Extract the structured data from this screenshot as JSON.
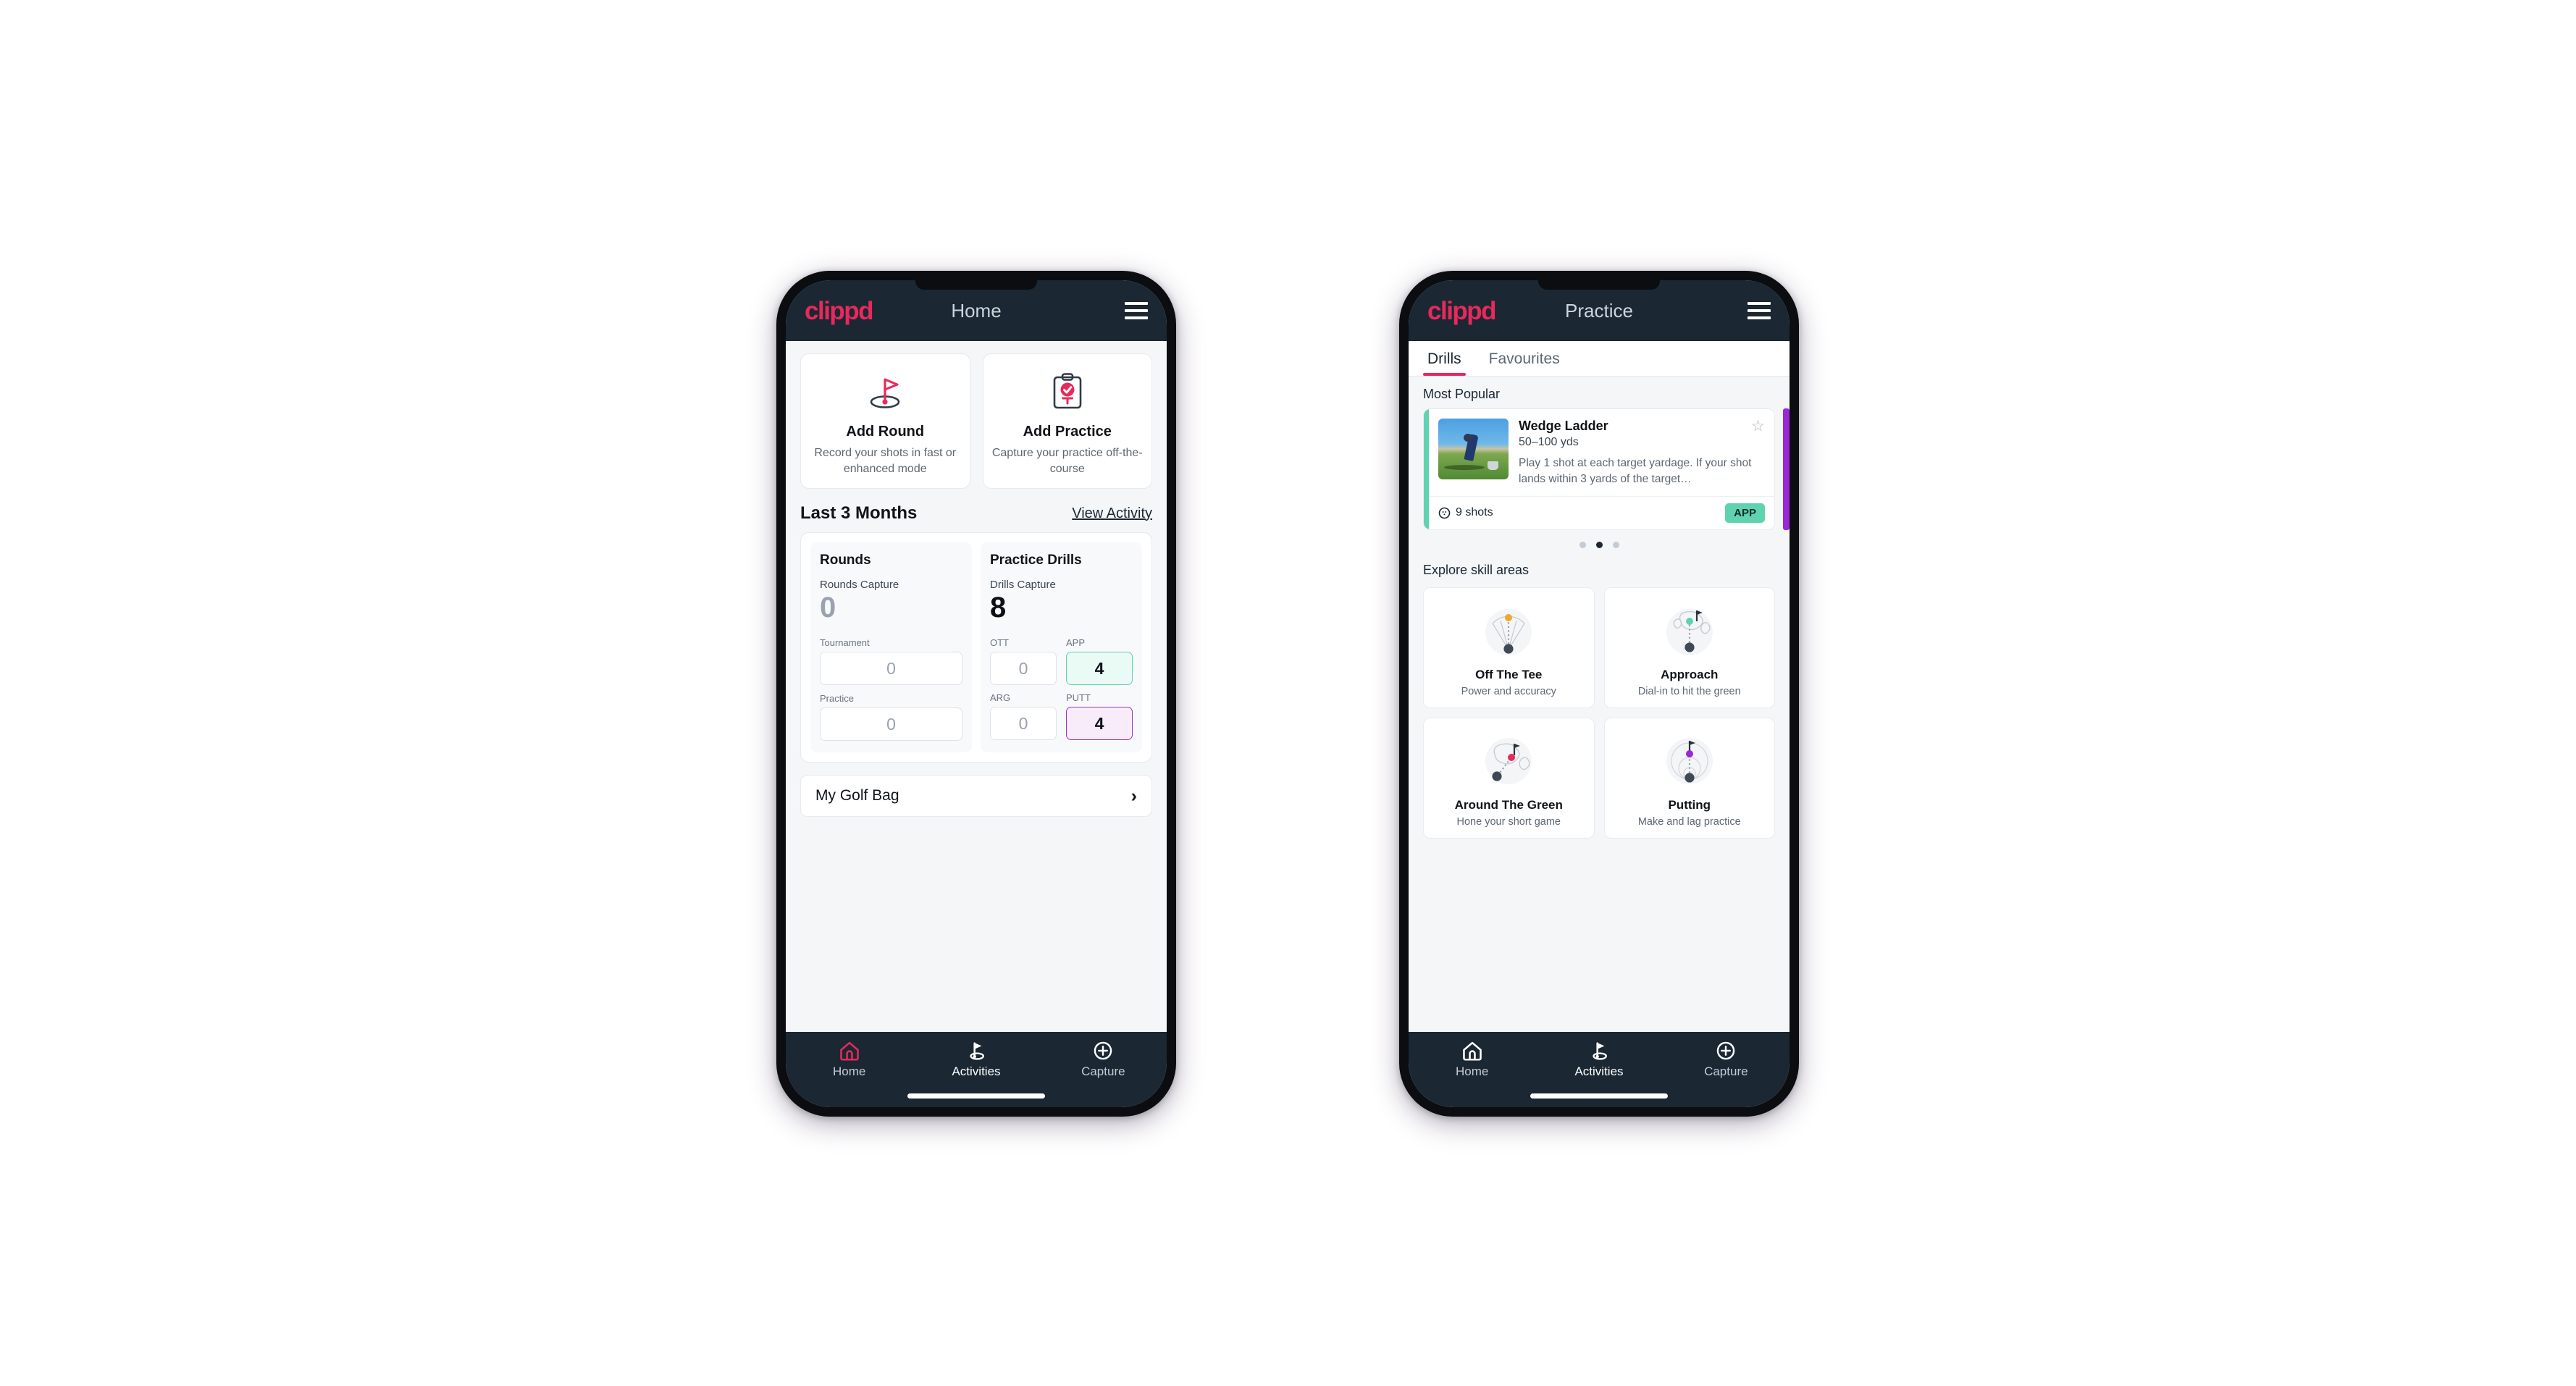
{
  "theme": {
    "brand_pink": "#e8295b",
    "navy": "#1b2733",
    "green_accent": "#5fd3b0",
    "purple_accent": "#9c36b5",
    "page_bg": "#f4f6f8"
  },
  "phone_home": {
    "appbar": {
      "logo": "clippd",
      "title": "Home",
      "menu_icon": "hamburger-menu-icon"
    },
    "actions": [
      {
        "icon": "golf-flag-hole-icon",
        "title": "Add Round",
        "subtitle": "Record your shots in fast or enhanced mode"
      },
      {
        "icon": "clipboard-check-tee-icon",
        "title": "Add Practice",
        "subtitle": "Capture your practice off-the-course"
      }
    ],
    "section": {
      "title": "Last 3 Months",
      "link": "View Activity"
    },
    "rounds": {
      "heading": "Rounds",
      "capture_label": "Rounds Capture",
      "capture_value": "0",
      "fields": [
        {
          "label": "Tournament",
          "value": "0",
          "accent": "none"
        },
        {
          "label": "Practice",
          "value": "0",
          "accent": "none"
        }
      ]
    },
    "drills": {
      "heading": "Practice Drills",
      "capture_label": "Drills Capture",
      "capture_value": "8",
      "fields": [
        {
          "label": "OTT",
          "value": "0",
          "accent": "none"
        },
        {
          "label": "APP",
          "value": "4",
          "accent": "green"
        },
        {
          "label": "ARG",
          "value": "0",
          "accent": "none"
        },
        {
          "label": "PUTT",
          "value": "4",
          "accent": "purple"
        }
      ]
    },
    "golf_bag": {
      "label": "My Golf Bag",
      "chevron": "chevron-right-icon"
    },
    "nav": [
      {
        "icon": "home-icon",
        "label": "Home",
        "state": "selected-pink-icon"
      },
      {
        "icon": "golf-flag-icon",
        "label": "Activities",
        "state": "default"
      },
      {
        "icon": "plus-circle-icon",
        "label": "Capture",
        "state": "default"
      }
    ]
  },
  "phone_practice": {
    "appbar": {
      "logo": "clippd",
      "title": "Practice",
      "menu_icon": "hamburger-menu-icon"
    },
    "tabs": [
      {
        "label": "Drills",
        "active": true
      },
      {
        "label": "Favourites",
        "active": false
      }
    ],
    "most_popular_label": "Most Popular",
    "drill_card": {
      "accent": "green",
      "title": "Wedge Ladder",
      "yardage": "50–100 yds",
      "description": "Play 1 shot at each target yardage. If your shot lands within 3 yards of the target…",
      "shots": "9 shots",
      "shots_icon": "golf-ball-icon",
      "badge": "APP",
      "favourite_icon": "star-outline-icon"
    },
    "carousel_dots": {
      "count": 3,
      "active_index": 1
    },
    "skill_section_label": "Explore skill areas",
    "skills": [
      {
        "icon": "tee-fan-icon",
        "name": "Off The Tee",
        "sub": "Power and accuracy",
        "dot_color": "#f0a82a"
      },
      {
        "icon": "green-target-icon",
        "name": "Approach",
        "sub": "Dial-in to hit the green",
        "dot_color": "#5fd3b0"
      },
      {
        "icon": "chip-green-icon",
        "name": "Around The Green",
        "sub": "Hone your short game",
        "dot_color": "#e8295b"
      },
      {
        "icon": "putt-rings-icon",
        "name": "Putting",
        "sub": "Make and lag practice",
        "dot_color": "#9c27d6"
      }
    ],
    "nav": [
      {
        "icon": "home-icon",
        "label": "Home",
        "state": "default"
      },
      {
        "icon": "golf-flag-icon",
        "label": "Activities",
        "state": "selected"
      },
      {
        "icon": "plus-circle-icon",
        "label": "Capture",
        "state": "default"
      }
    ]
  }
}
